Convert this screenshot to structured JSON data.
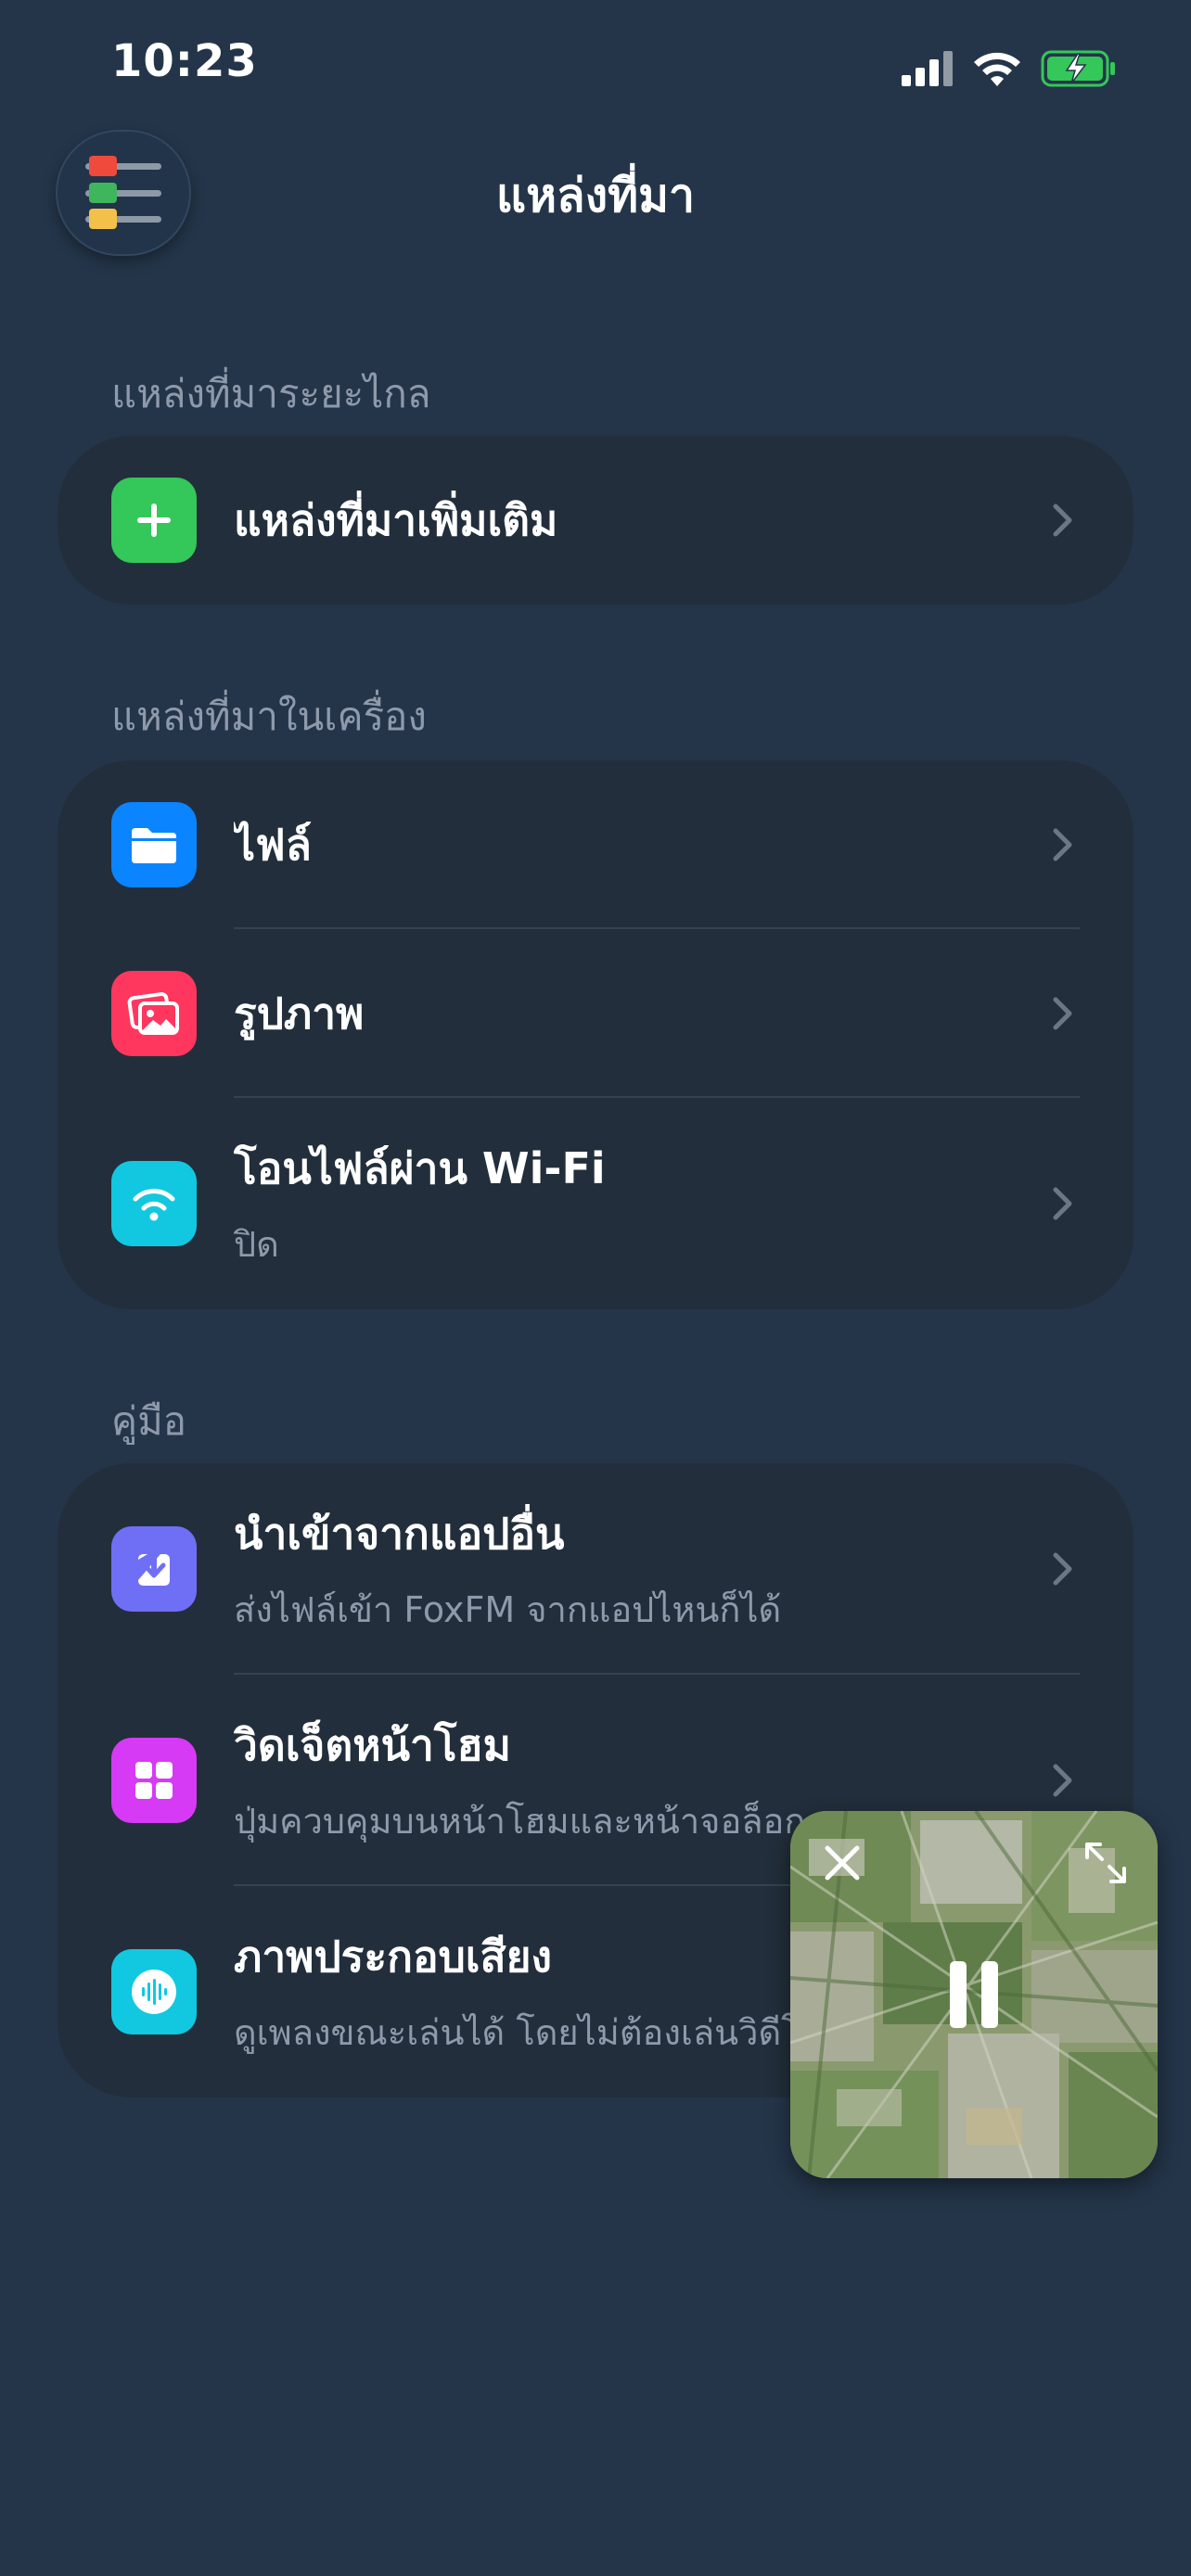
{
  "status": {
    "time": "10:23"
  },
  "nav": {
    "title": "แหล่งที่มา"
  },
  "sections": {
    "remote": {
      "header": "แหล่งที่มาระยะไกล",
      "add_source": {
        "title": "แหล่งที่มาเพิ่มเติม"
      }
    },
    "local": {
      "header": "แหล่งที่มาในเครื่อง",
      "files": {
        "title": "ไฟล์"
      },
      "photos": {
        "title": "รูปภาพ"
      },
      "wifi": {
        "title": "โอนไฟล์ผ่าน Wi-Fi",
        "subtitle": "ปิด"
      }
    },
    "guide": {
      "header": "คู่มือ",
      "import": {
        "title": "นำเข้าจากแอปอื่น",
        "subtitle": "ส่งไฟล์เข้า FoxFM จากแอปไหนก็ได้"
      },
      "widget": {
        "title": "วิดเจ็ตหน้าโฮม",
        "subtitle": "ปุ่มควบคุมบนหน้าโฮมและหน้าจอล็อก"
      },
      "visualizer": {
        "title": "ภาพประกอบเสียง",
        "subtitle": "ดูเพลงขณะเล่นได้ โดยไม่ต้องเล่นวิดีโอ"
      }
    }
  },
  "icons": {
    "menu": "sliders-menu-icon",
    "add": "plus-icon",
    "files": "folder-icon",
    "photos": "photos-icon",
    "wifi": "wifi-icon",
    "import": "download-tray-icon",
    "widget": "widget-grid-icon",
    "visualizer": "audio-waveform-icon",
    "chevron": "chevron-right-icon",
    "pip_close": "close-icon",
    "pip_expand": "expand-icon",
    "pip_pause": "pause-icon"
  },
  "colors": {
    "background": "#243549",
    "card": "#222e3b",
    "secondary_text": "#8e9aab",
    "green": "#34c759",
    "blue": "#0a84ff",
    "pink": "#ff375f",
    "cyan": "#12c8e0",
    "indigo": "#6f6ff5",
    "magenta": "#d63af5"
  }
}
